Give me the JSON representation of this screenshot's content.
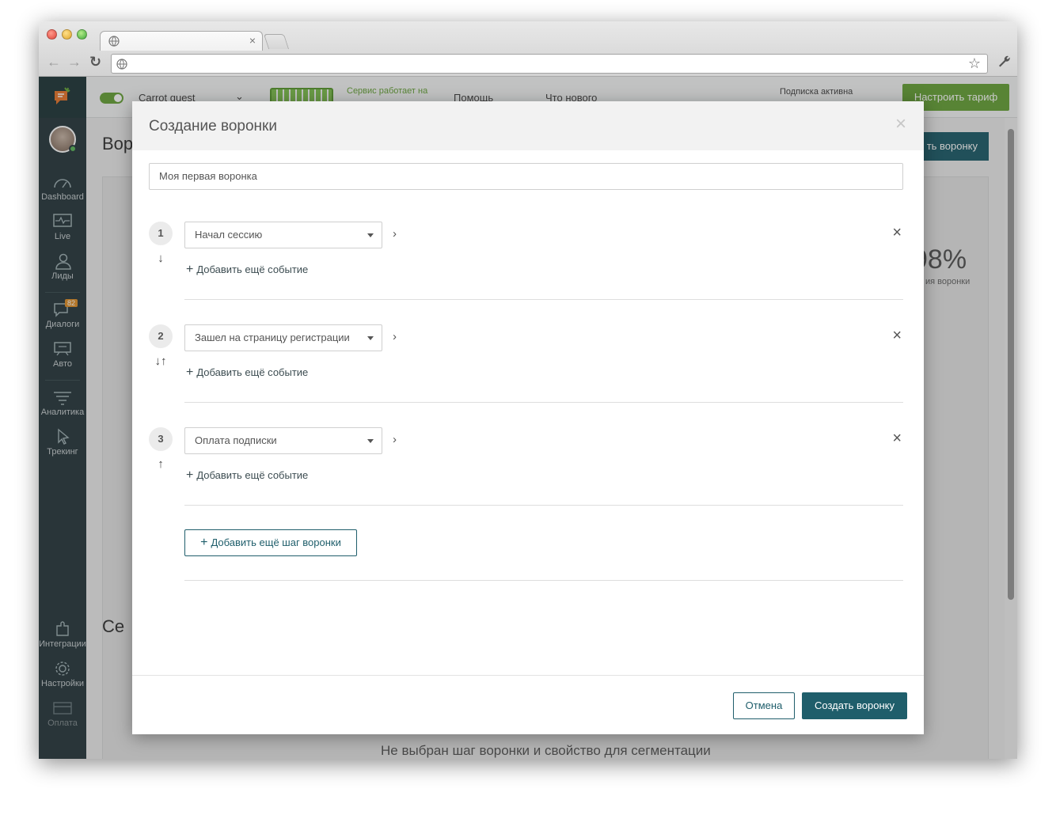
{
  "browser": {
    "tab_close": "×",
    "back": "←",
    "forward": "→",
    "reload": "↻",
    "bookmark": "☆",
    "settings": "🔧"
  },
  "sidebar": {
    "items": [
      {
        "label": "Dashboard",
        "icon": "speedometer-icon"
      },
      {
        "label": "Live",
        "icon": "pulse-monitor-icon"
      },
      {
        "label": "Лиды",
        "icon": "users-icon"
      },
      {
        "label": "Диалоги",
        "icon": "chat-icon",
        "badge": "82"
      },
      {
        "label": "Авто",
        "icon": "auto-message-icon"
      },
      {
        "label": "Аналитика",
        "icon": "funnel-icon"
      },
      {
        "label": "Трекинг",
        "icon": "cursor-icon"
      },
      {
        "label": "Интеграции",
        "icon": "puzzle-icon"
      },
      {
        "label": "Настройки",
        "icon": "gear-icon"
      },
      {
        "label": "Оплата",
        "icon": "credit-card-icon"
      }
    ]
  },
  "topbar": {
    "project": "Carrot quest",
    "service_status": "Сервис работает на",
    "help": "Помощь",
    "whats_new": "Что нового",
    "subscription": "Подписка активна",
    "tariff_button": "Настроить тариф"
  },
  "background": {
    "page_title": "Вор",
    "create_button": "ть воронку",
    "percent": "98%",
    "percent_label": "ия воронки",
    "empty_text": "Не выбран шаг воронки и свойство для сегментации",
    "section_title": "Се"
  },
  "modal": {
    "title": "Создание воронки",
    "close": "×",
    "name_value": "Моя первая воронка",
    "add_event_label": "Добавить ещё событие",
    "steps": [
      {
        "number": "1",
        "event": "Начал сессию",
        "arrows": "↓"
      },
      {
        "number": "2",
        "event": "Зашел на страницу регистрации",
        "arrows": "↓↑"
      },
      {
        "number": "3",
        "event": "Оплата подписки",
        "arrows": "↑"
      }
    ],
    "add_step_label": "Добавить ещё шаг воронки",
    "cancel_label": "Отмена",
    "create_label": "Создать воронку"
  },
  "colors": {
    "primary": "#1f5e6b",
    "sidebar": "#2a3a3f",
    "accent_green": "#68a33a",
    "chat_button": "#1e8ec9"
  }
}
